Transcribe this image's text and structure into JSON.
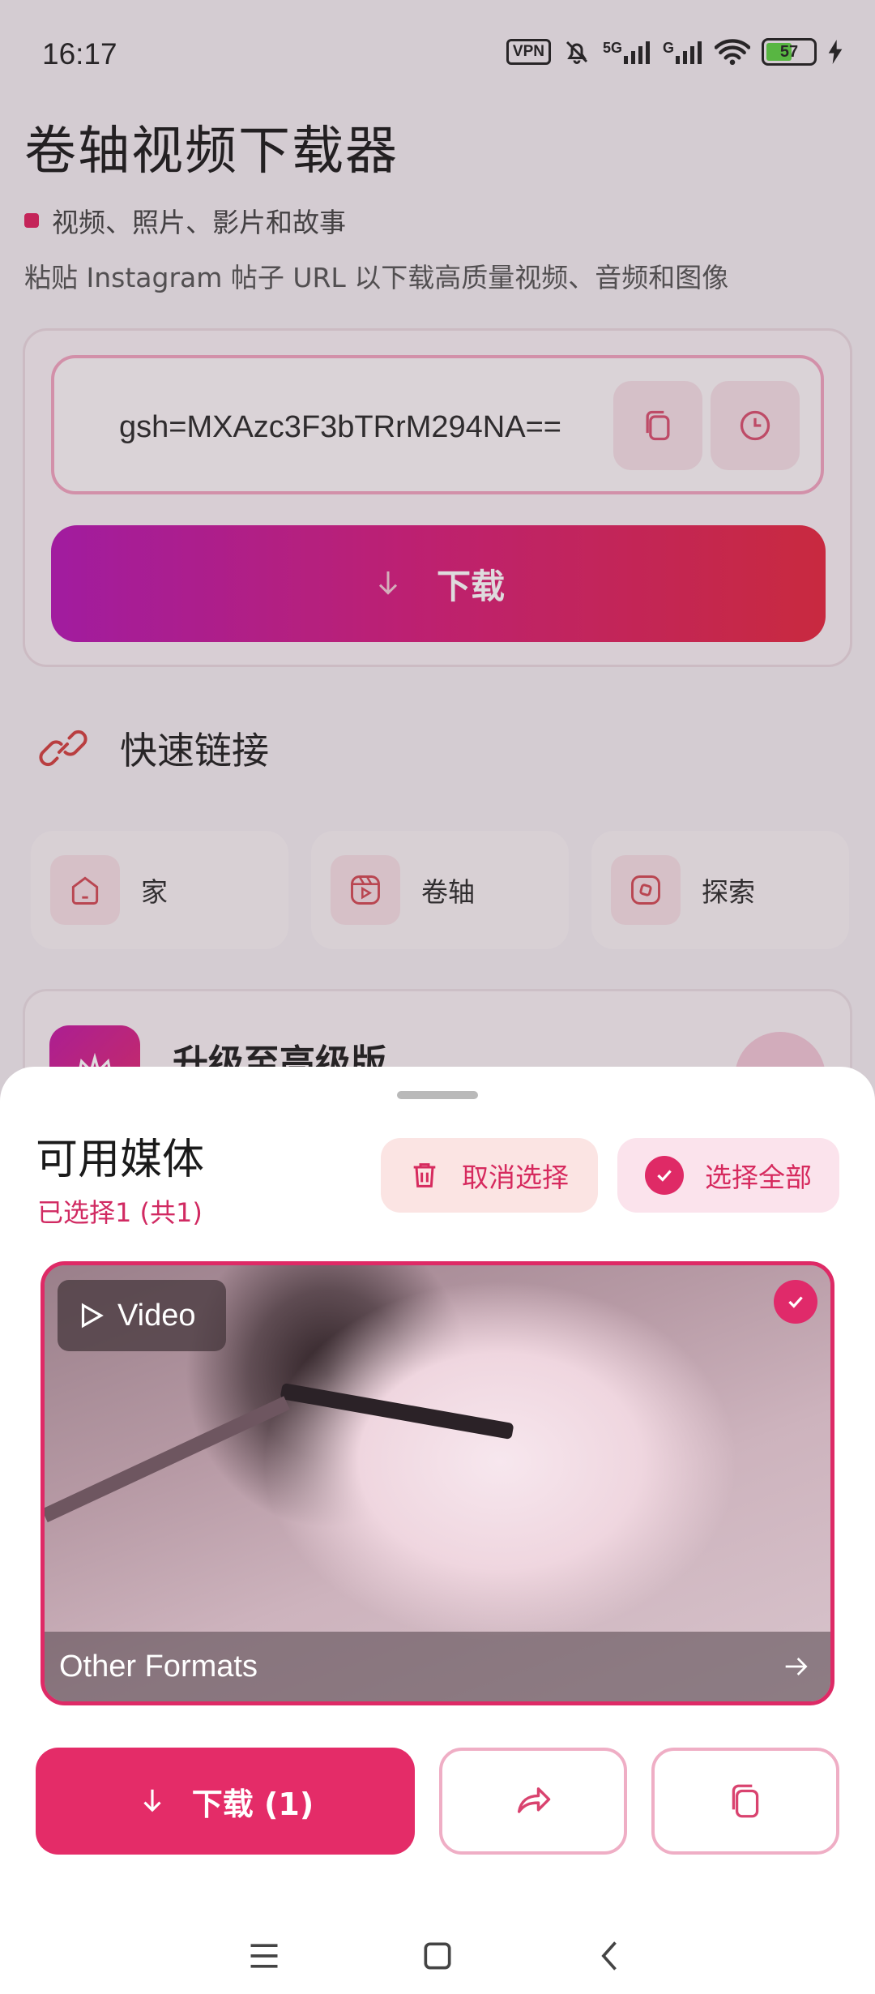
{
  "status_bar": {
    "time": "16:17",
    "vpn": "VPN",
    "signal1": "5G",
    "signal2": "G",
    "battery": "57",
    "battery_color": "#5cd243"
  },
  "header": {
    "title": "卷轴视频下载器",
    "subtitle": "视频、照片、影片和故事",
    "description": "粘贴 Instagram 帖子 URL 以下载高质量视频、音频和图像"
  },
  "url_input": {
    "value": "gsh=MXAzc3F3bTRrM294NA==",
    "paste_icon": "paste-icon",
    "history_icon": "history-icon"
  },
  "download_button": {
    "label": "下载",
    "gradient": [
      "#b517b4",
      "#e5273f"
    ]
  },
  "quick_links": {
    "title": "快速链接",
    "items": [
      {
        "label": "家",
        "icon": "home-icon"
      },
      {
        "label": "卷轴",
        "icon": "reels-icon"
      },
      {
        "label": "探索",
        "icon": "explore-icon"
      }
    ]
  },
  "promo": {
    "title": "升级至高级版"
  },
  "sheet": {
    "title": "可用媒体",
    "selection": "已选择1 (共1)",
    "deselect_label": "取消选择",
    "select_all_label": "选择全部",
    "media": [
      {
        "type_label": "Video",
        "formats_label": "Other Formats",
        "selected": true
      }
    ],
    "download_label": "下载 (1)",
    "accent": "#e42c68"
  }
}
